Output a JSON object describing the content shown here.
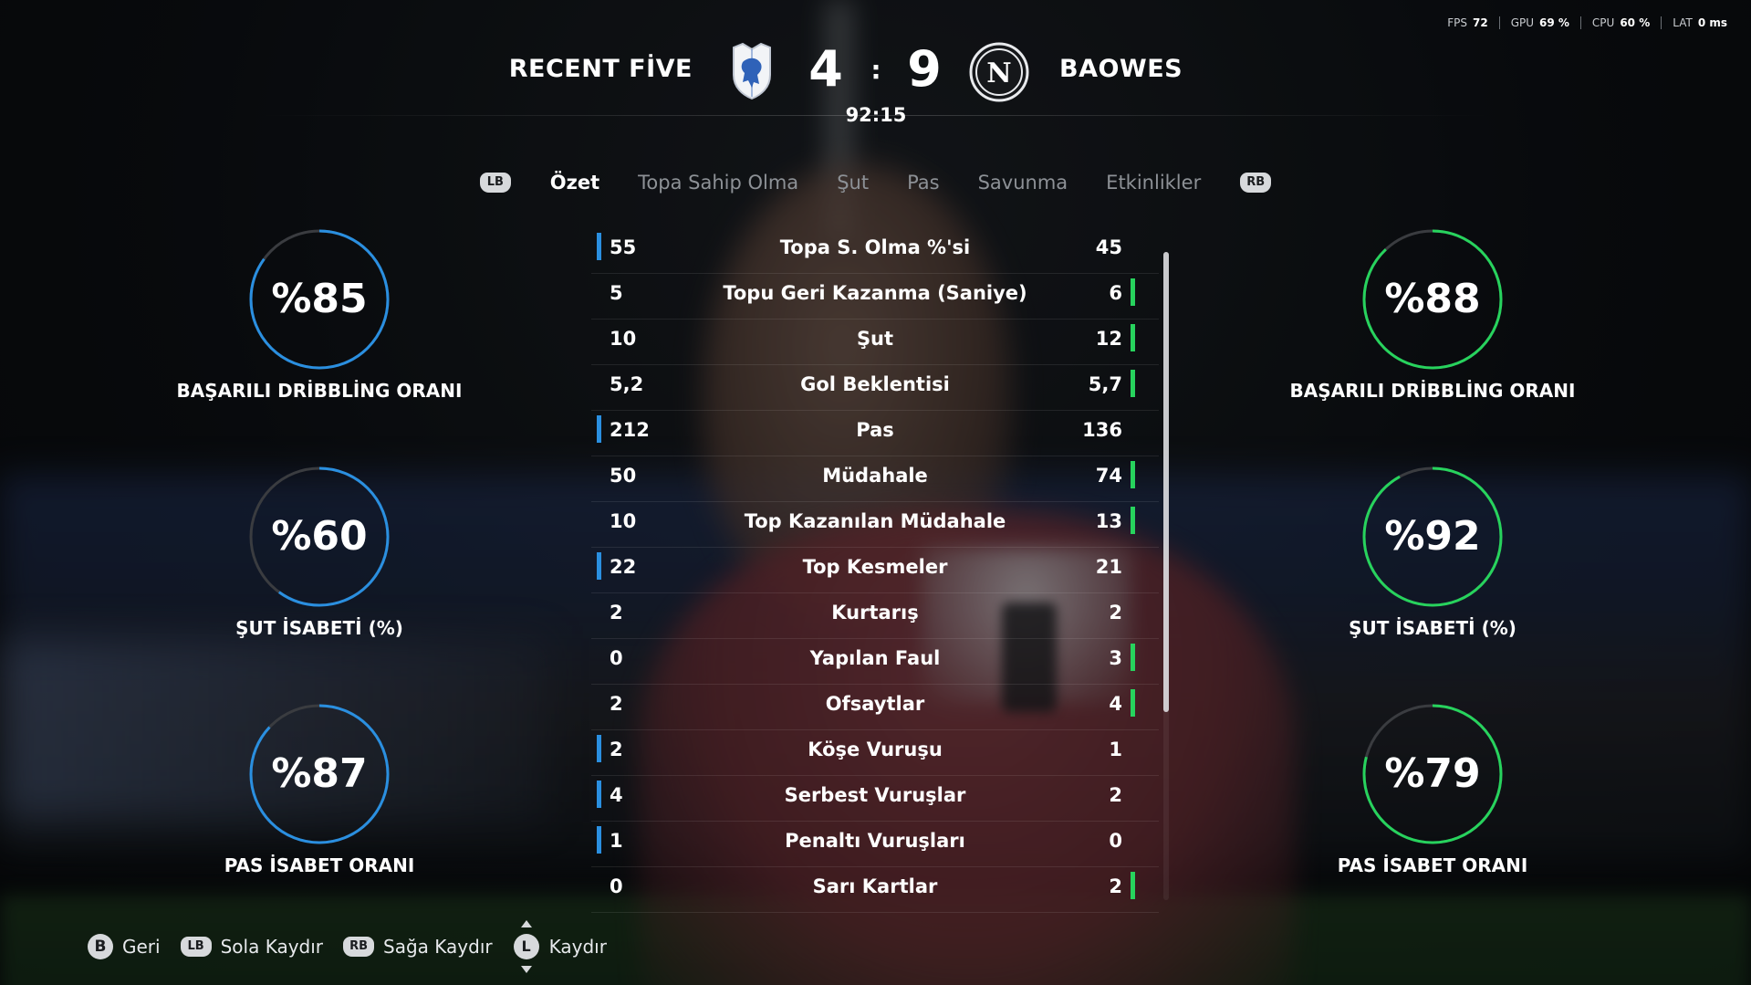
{
  "perf": {
    "fps_label": "FPS",
    "fps_value": "72",
    "gpu_label": "GPU",
    "gpu_value": "69 %",
    "cpu_label": "CPU",
    "cpu_value": "60 %",
    "lat_label": "LAT",
    "lat_value": "0 ms"
  },
  "match": {
    "home_team": "RECENT FİVE",
    "away_team": "BAOWES",
    "home_score": "4",
    "separator": ":",
    "away_score": "9",
    "clock": "92:15",
    "away_crest_letter": "N"
  },
  "tabs": {
    "lb": "LB",
    "rb": "RB",
    "items": [
      "Özet",
      "Topa Sahip Olma",
      "Şut",
      "Pas",
      "Savunma",
      "Etkinlikler"
    ],
    "active_index": 0
  },
  "colors": {
    "home": "#2a8fe0",
    "away": "#27d35d",
    "ring_bg": "#3a3c40"
  },
  "home_rings": [
    {
      "value": "%85",
      "percent": 85,
      "label": "BAŞARILI DRİBBLİNG ORANI"
    },
    {
      "value": "%60",
      "percent": 60,
      "label": "ŞUT İSABETİ (%)"
    },
    {
      "value": "%87",
      "percent": 87,
      "label": "PAS İSABET ORANI"
    }
  ],
  "away_rings": [
    {
      "value": "%88",
      "percent": 88,
      "label": "BAŞARILI DRİBBLİNG ORANI"
    },
    {
      "value": "%92",
      "percent": 92,
      "label": "ŞUT İSABETİ (%)"
    },
    {
      "value": "%79",
      "percent": 79,
      "label": "PAS İSABET ORANI"
    }
  ],
  "stats": [
    {
      "left": "55",
      "label": "Topa S. Olma %'si",
      "right": "45",
      "lead": "home"
    },
    {
      "left": "5",
      "label": "Topu Geri Kazanma (Saniye)",
      "right": "6",
      "lead": "away"
    },
    {
      "left": "10",
      "label": "Şut",
      "right": "12",
      "lead": "away"
    },
    {
      "left": "5,2",
      "label": "Gol Beklentisi",
      "right": "5,7",
      "lead": "away"
    },
    {
      "left": "212",
      "label": "Pas",
      "right": "136",
      "lead": "home"
    },
    {
      "left": "50",
      "label": "Müdahale",
      "right": "74",
      "lead": "away"
    },
    {
      "left": "10",
      "label": "Top Kazanılan Müdahale",
      "right": "13",
      "lead": "away"
    },
    {
      "left": "22",
      "label": "Top Kesmeler",
      "right": "21",
      "lead": "home"
    },
    {
      "left": "2",
      "label": "Kurtarış",
      "right": "2",
      "lead": "none"
    },
    {
      "left": "0",
      "label": "Yapılan Faul",
      "right": "3",
      "lead": "away"
    },
    {
      "left": "2",
      "label": "Ofsaytlar",
      "right": "4",
      "lead": "away"
    },
    {
      "left": "2",
      "label": "Köşe Vuruşu",
      "right": "1",
      "lead": "home"
    },
    {
      "left": "4",
      "label": "Serbest Vuruşlar",
      "right": "2",
      "lead": "home"
    },
    {
      "left": "1",
      "label": "Penaltı Vuruşları",
      "right": "0",
      "lead": "home"
    },
    {
      "left": "0",
      "label": "Sarı Kartlar",
      "right": "2",
      "lead": "away"
    }
  ],
  "footer": {
    "back_key": "B",
    "back_label": "Geri",
    "left_key": "LB",
    "left_label": "Sola Kaydır",
    "right_key": "RB",
    "right_label": "Sağa Kaydır",
    "scroll_key": "L",
    "scroll_label": "Kaydır"
  }
}
